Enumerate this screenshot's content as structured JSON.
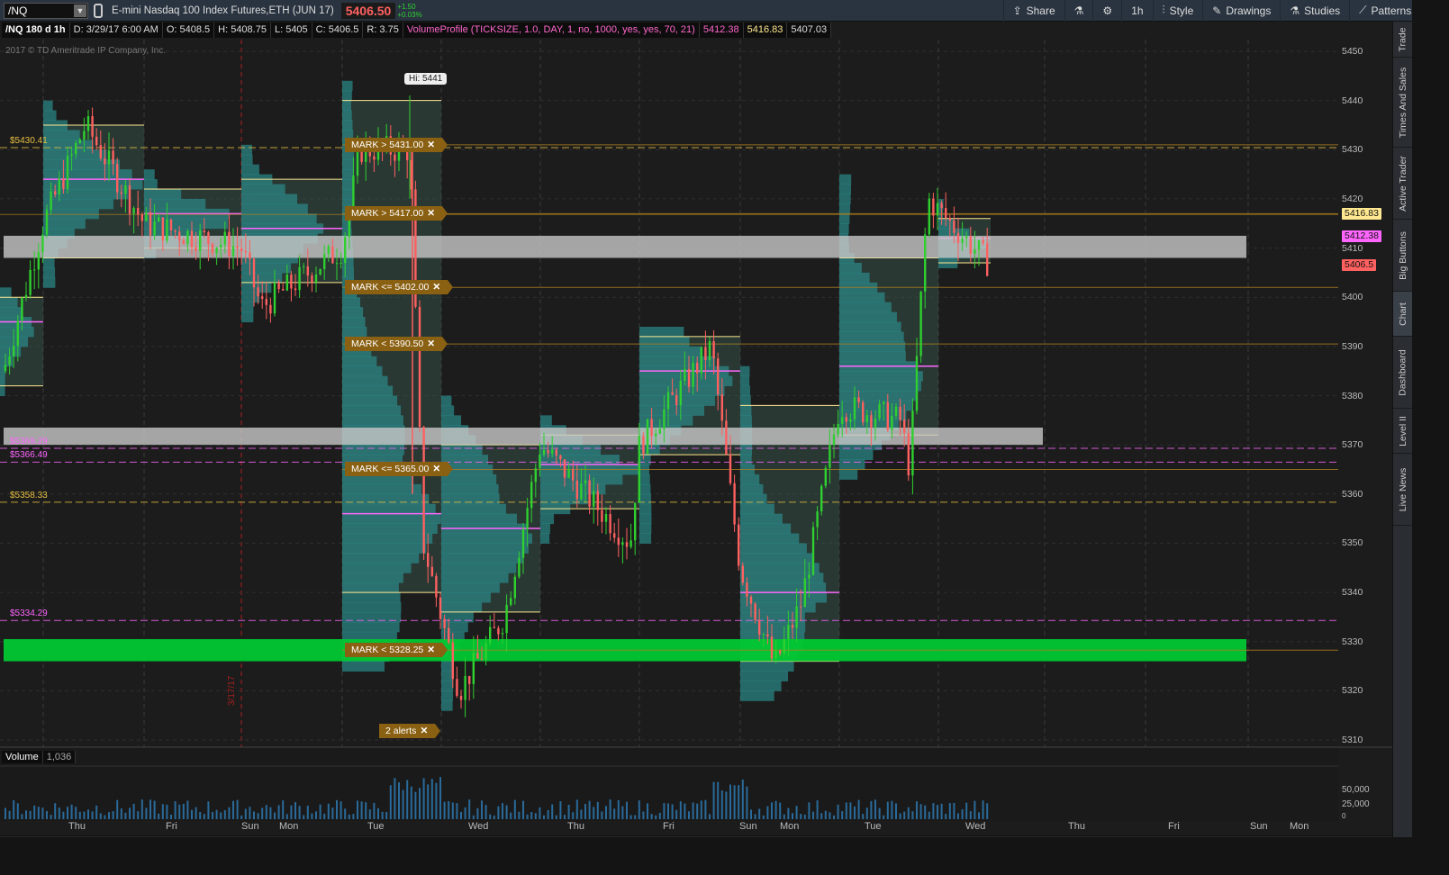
{
  "topbar": {
    "symbol": "/NQ",
    "instrument_name": "E-mini Nasdaq 100 Index Futures,ETH (JUN 17)",
    "last_price": "5406.50",
    "change_abs": "+1.50",
    "change_pct": "+0.03%",
    "share_label": "Share",
    "timeframe_label": "1h",
    "style_label": "Style",
    "drawings_label": "Drawings",
    "studies_label": "Studies",
    "patterns_label": "Patterns"
  },
  "info_bar": {
    "chart_desc": "/NQ 180 d 1h",
    "date": "D: 3/29/17 6:00 AM",
    "open": "O: 5408.5",
    "high": "H: 5408.75",
    "low": "L: 5405",
    "close": "C: 5406.5",
    "range": "R: 3.75",
    "study": "VolumeProfile (TICKSIZE, 1.0, DAY, 1, no, 1000, yes, yes, 70, 21)",
    "study_val1": "5412.38",
    "study_val2": "5416.83",
    "study_val3": "5407.03"
  },
  "copyright": "2017 © TD Ameritrade IP Company, Inc.",
  "hi_label": "Hi: 5441",
  "alerts": [
    {
      "label": "MARK > 5431.00",
      "price": 5431
    },
    {
      "label": "MARK > 5417.00",
      "price": 5417
    },
    {
      "label": "MARK <= 5402.00",
      "price": 5402
    },
    {
      "label": "MARK < 5390.50",
      "price": 5390.5
    },
    {
      "label": "MARK <= 5365.00",
      "price": 5365
    },
    {
      "label": "MARK < 5328.25",
      "price": 5328.25
    }
  ],
  "alerts_count_label": "2 alerts",
  "level_labels": [
    {
      "text": "$5430.41",
      "price": 5430.41,
      "color": "#e8c040"
    },
    {
      "text": "$5369.29",
      "price": 5369.29,
      "color": "#ff66ff"
    },
    {
      "text": "$5366.49",
      "price": 5366.49,
      "color": "#ff66ff"
    },
    {
      "text": "$5358.33",
      "price": 5358.33,
      "color": "#e8c040"
    },
    {
      "text": "$5334.29",
      "price": 5334.29,
      "color": "#ff66ff"
    }
  ],
  "price_badges": [
    {
      "text": "5416.83",
      "price": 5416.83,
      "color": "#ffe890"
    },
    {
      "text": "5412.38",
      "price": 5412.38,
      "color": "#ff66ff"
    },
    {
      "text": "5406.5",
      "price": 5406.5,
      "color": "#ff6060"
    }
  ],
  "price_axis": [
    "5450",
    "5440",
    "5430",
    "5420",
    "5410",
    "5400",
    "5390",
    "5380",
    "5370",
    "5360",
    "5350",
    "5340",
    "5330",
    "5320",
    "5310"
  ],
  "volume": {
    "label": "Volume",
    "value": "1,036",
    "axis": [
      "50,000",
      "25,000",
      "0"
    ]
  },
  "time_axis": [
    "Thu",
    "Fri",
    "Sun",
    "Mon",
    "Tue",
    "Wed",
    "Thu",
    "Fri",
    "Sun",
    "Mon",
    "Tue",
    "Wed",
    "Thu",
    "Fri",
    "Sun",
    "Mon"
  ],
  "vertical_date_label": "3/17/17",
  "right_rail": [
    "Trade",
    "Times And Sales",
    "Active Trader",
    "Big Buttons",
    "Chart",
    "Dashboard",
    "Level II",
    "Live News"
  ],
  "colors": {
    "up": "#2fd02f",
    "down": "#ff6060",
    "profile": "#2b8a8a",
    "value_area": "#3a5a50",
    "zone_grey": "#c8c8c8",
    "zone_green": "#00c832",
    "alert": "#8a6012"
  },
  "chart_data": {
    "type": "candlestick",
    "ylim": [
      5308,
      5452
    ],
    "last": 5406.5,
    "high_marker": 5441,
    "zones": [
      {
        "low": 5408,
        "high": 5412.5,
        "color": "grey"
      },
      {
        "low": 5370,
        "high": 5373.5,
        "color": "grey"
      },
      {
        "low": 5326,
        "high": 5330.5,
        "color": "green"
      }
    ]
  }
}
